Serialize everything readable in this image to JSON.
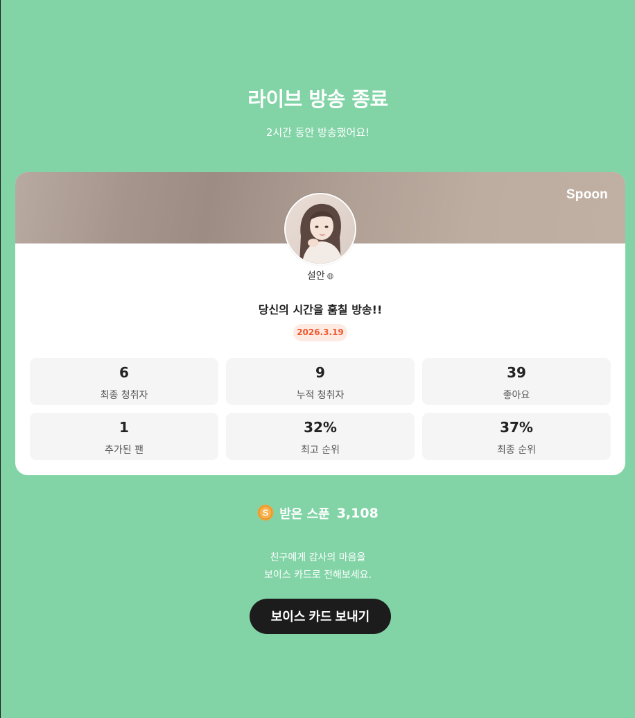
{
  "header": {
    "title": "라이브 방송 종료",
    "subtitle": "2시간 동안 방송했어요!"
  },
  "card": {
    "brand": "Spoon",
    "host_name": "설안",
    "host_badge_icon": "globe-icon",
    "broadcast_title": "당신의 시간을 훔칠 방송!!",
    "date": "2026.3.19",
    "stats": [
      {
        "value": "6",
        "label": "최종 청취자"
      },
      {
        "value": "9",
        "label": "누적 청취자"
      },
      {
        "value": "39",
        "label": "좋아요"
      },
      {
        "value": "1",
        "label": "추가된 팬"
      },
      {
        "value": "32%",
        "label": "최고 순위"
      },
      {
        "value": "37%",
        "label": "최종 순위"
      }
    ]
  },
  "spoons": {
    "icon": "spoon-coin-icon",
    "label": "받은 스푼",
    "count": "3,108"
  },
  "thanks": {
    "line1": "친구에게 감사의 마음을",
    "line2": "보이스 카드로 전해보세요."
  },
  "cta": {
    "label": "보이스 카드 보내기"
  },
  "colors": {
    "background": "#82d4a7",
    "date_pill_bg": "#fdebe3",
    "date_pill_text": "#f0562b",
    "cta_bg": "#1c1c1c",
    "coin": "#f2a23a"
  }
}
